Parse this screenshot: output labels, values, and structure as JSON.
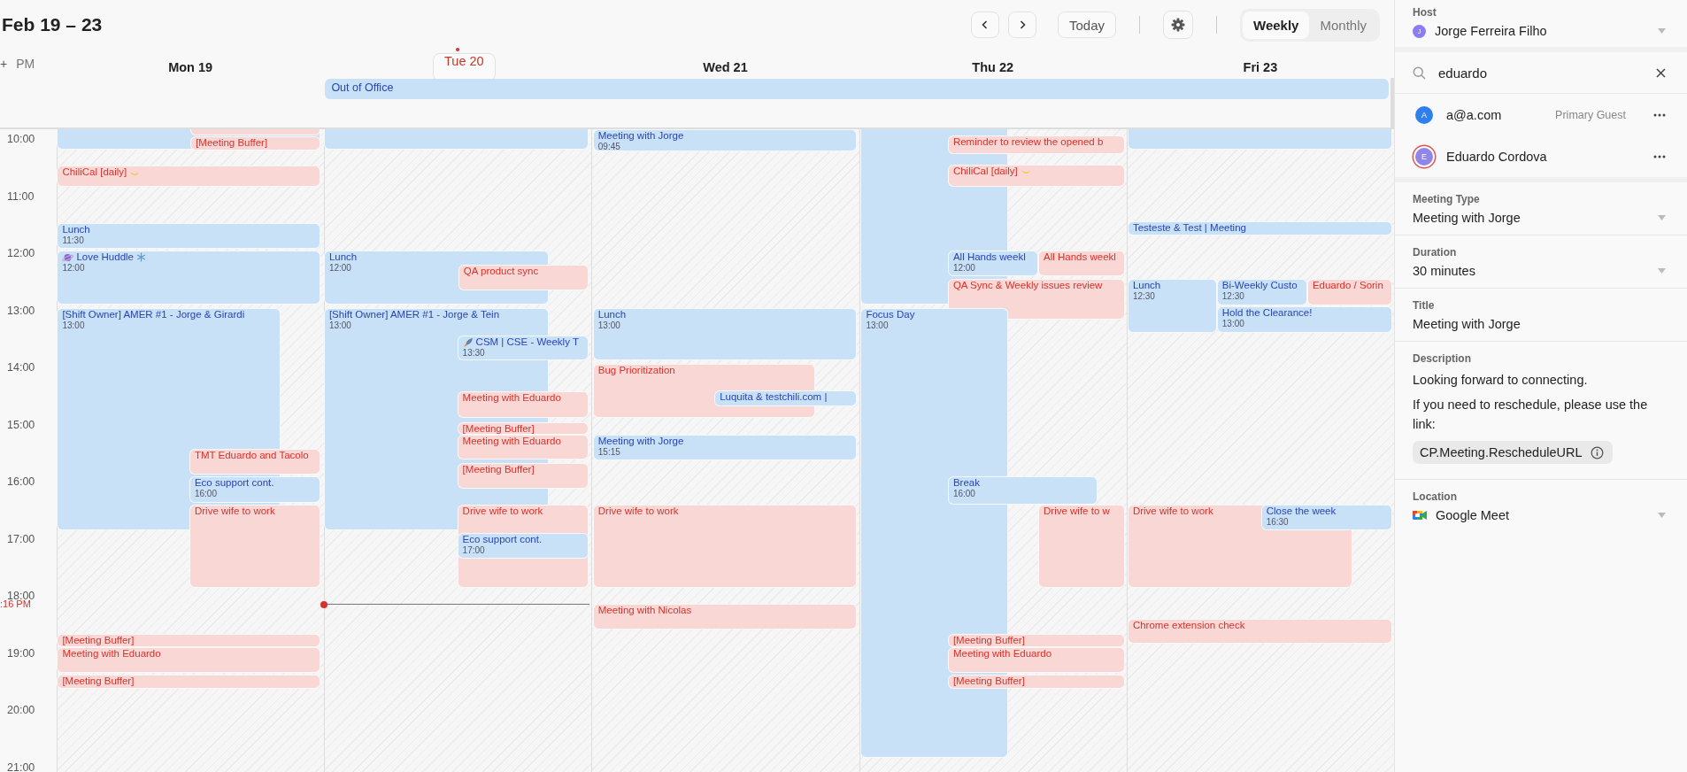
{
  "header": {
    "title": "Feb 19 – 23",
    "today_button": "Today",
    "views": [
      {
        "label": "Weekly",
        "selected": true
      },
      {
        "label": "Monthly",
        "selected": false
      }
    ]
  },
  "gutter": {
    "prefix": "+",
    "label": "PM"
  },
  "all_day_events": [
    {
      "title": "Out of Office",
      "color": "#c8e1f6"
    }
  ],
  "days": [
    {
      "label": "Mon 19",
      "today": false,
      "events": [
        {
          "color": "#c8e1f6"
        },
        {
          "color": "#f8d7d5"
        },
        {
          "title": "[Meeting Buffer]",
          "color": "#f8d7d5"
        },
        {
          "title": "ChiliCal [daily]",
          "color": "#f8d7d5"
        },
        {
          "title": "Lunch",
          "time": "11:30",
          "color": "#c8e1f6"
        },
        {
          "title": "Love Huddle",
          "time": "12:00",
          "color": "#c8e1f6"
        },
        {
          "title": "[Shift Owner] AMER #1 - Jorge & Girardi",
          "time": "13:00",
          "color": "#c8e1f6"
        },
        {
          "title": "TMT Eduardo and Tacolo",
          "color": "#f8d7d5"
        },
        {
          "title": "Eco support cont.",
          "time": "16:00",
          "color": "#c8e1f6"
        },
        {
          "title": "Drive wife to work",
          "color": "#f8d7d5"
        },
        {
          "title": "[Meeting Buffer]",
          "color": "#f8d7d5"
        },
        {
          "title": "Meeting with Eduardo",
          "color": "#f8d7d5"
        },
        {
          "title": "[Meeting Buffer]",
          "color": "#f8d7d5"
        }
      ]
    },
    {
      "label": "Tue 20",
      "today": true,
      "events": [
        {
          "color": "#c8e1f6"
        },
        {
          "title": "Lunch",
          "time": "12:00",
          "color": "#c8e1f6"
        },
        {
          "title": "QA product sync",
          "color": "#f8d7d5"
        },
        {
          "title": "[Shift Owner] AMER #1 - Jorge & Tein",
          "time": "13:00",
          "color": "#c8e1f6"
        },
        {
          "title": "CSM | CSE - Weekly T",
          "time": "13:30",
          "color": "#c8e1f6"
        },
        {
          "title": "Meeting with Eduardo",
          "color": "#f8d7d5"
        },
        {
          "title": "[Meeting Buffer]",
          "color": "#f8d7d5"
        },
        {
          "title": "Meeting with Eduardo",
          "color": "#f8d7d5"
        },
        {
          "title": "[Meeting Buffer]",
          "color": "#f8d7d5"
        },
        {
          "title": "Drive wife to work",
          "color": "#f8d7d5"
        },
        {
          "title": "Eco support cont.",
          "time": "17:00",
          "color": "#c8e1f6"
        }
      ]
    },
    {
      "label": "Wed 21",
      "today": false,
      "events": [
        {
          "title": "Meeting with Jorge",
          "time": "09:45",
          "color": "#c8e1f6"
        },
        {
          "title": "Lunch",
          "time": "13:00",
          "color": "#c8e1f6"
        },
        {
          "title": "Bug Prioritization",
          "color": "#f8d7d5"
        },
        {
          "title": "Luquita & testchili.com |",
          "color": "#c8e1f6"
        },
        {
          "title": "Meeting with Jorge",
          "time": "15:15",
          "color": "#c8e1f6"
        },
        {
          "title": "Drive wife to work",
          "color": "#f8d7d5"
        },
        {
          "title": "Meeting with Nicolas",
          "color": "#f8d7d5"
        }
      ]
    },
    {
      "label": "Thu 22",
      "today": false,
      "events": [
        {
          "color": "#c8e1f6"
        },
        {
          "title": "Reminder to review the opened b",
          "color": "#f8d7d5"
        },
        {
          "title": "ChiliCal [daily]",
          "color": "#f8d7d5"
        },
        {
          "title": "All Hands weekl",
          "time": "12:00",
          "color": "#c8e1f6"
        },
        {
          "title": "All Hands weekl",
          "color": "#f8d7d5"
        },
        {
          "title": "QA Sync & Weekly issues review",
          "color": "#f8d7d5"
        },
        {
          "title": "Focus Day",
          "time": "13:00",
          "color": "#c8e1f6"
        },
        {
          "title": "Break",
          "time": "16:00",
          "color": "#c8e1f6"
        },
        {
          "title": "Drive wife to w",
          "color": "#f8d7d5"
        },
        {
          "title": "[Meeting Buffer]",
          "color": "#f8d7d5"
        },
        {
          "title": "Meeting with Eduardo",
          "color": "#f8d7d5"
        },
        {
          "title": "[Meeting Buffer]",
          "color": "#f8d7d5"
        }
      ]
    },
    {
      "label": "Fri 23",
      "today": false,
      "events": [
        {
          "color": "#c8e1f6"
        },
        {
          "title": "Testeste & Test | Meeting",
          "color": "#c8e1f6"
        },
        {
          "title": "Lunch",
          "time": "12:30",
          "color": "#c8e1f6"
        },
        {
          "title": "Bi-Weekly Custo",
          "time": "12:30",
          "color": "#c8e1f6"
        },
        {
          "title": "Eduardo / Sorin",
          "color": "#f8d7d5"
        },
        {
          "title": "Hold the Clearance!",
          "time": "13:00",
          "color": "#c8e1f6"
        },
        {
          "title": "Drive wife to work",
          "color": "#f8d7d5"
        },
        {
          "title": "Close the week",
          "time": "16:30",
          "color": "#c8e1f6"
        },
        {
          "title": "Chrome extension check",
          "color": "#f8d7d5"
        }
      ]
    }
  ],
  "hours": [
    "10:00",
    "11:00",
    "12:00",
    "13:00",
    "14:00",
    "15:00",
    "16:00",
    "17:00",
    "18:00",
    "19:00",
    "20:00",
    "21:00"
  ],
  "now": {
    "label": ":16 PM"
  },
  "panel": {
    "host": {
      "label": "Host",
      "avatar": "J",
      "color": "#8b7cf0",
      "name": "Jorge Ferreira Filho"
    },
    "search": {
      "value": "eduardo"
    },
    "guests": [
      {
        "avatar": "A",
        "color": "#2f80ed",
        "name": "a@a.com",
        "role": "Primary Guest",
        "highlighted": false
      },
      {
        "avatar": "E",
        "color": "#8f86e8",
        "name": "Eduardo Cordova",
        "highlighted": true
      }
    ],
    "fields": [
      {
        "label": "Meeting Type",
        "value": "Meeting with Jorge",
        "kind": "dropdown"
      },
      {
        "label": "Duration",
        "value": "30 minutes",
        "kind": "dropdown"
      },
      {
        "label": "Title",
        "value": "Meeting with Jorge",
        "kind": "text"
      }
    ],
    "description": {
      "label": "Description",
      "paragraphs": [
        "Looking forward to connecting.",
        "If you need to reschedule, please use the link:"
      ],
      "chip": "CP.Meeting.RescheduleURL"
    },
    "location": {
      "label": "Location",
      "value": "Google Meet"
    }
  }
}
